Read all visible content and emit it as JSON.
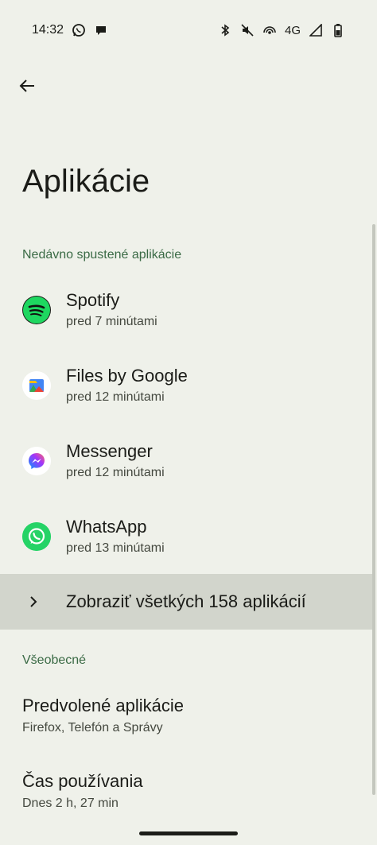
{
  "status": {
    "time": "14:32",
    "network": "4G"
  },
  "page": {
    "title": "Aplikácie"
  },
  "recent": {
    "header": "Nedávno spustené aplikácie",
    "apps": [
      {
        "name": "Spotify",
        "sub": "pred 7 minútami",
        "icon": "spotify-icon"
      },
      {
        "name": "Files by Google",
        "sub": "pred 12 minútami",
        "icon": "files-icon"
      },
      {
        "name": "Messenger",
        "sub": "pred 12 minútami",
        "icon": "messenger-icon"
      },
      {
        "name": "WhatsApp",
        "sub": "pred 13 minútami",
        "icon": "whatsapp-icon"
      }
    ],
    "show_all": "Zobraziť všetkých 158 aplikácií"
  },
  "general": {
    "header": "Všeobecné",
    "items": [
      {
        "title": "Predvolené aplikácie",
        "sub": "Firefox, Telefón a Správy"
      },
      {
        "title": "Čas používania",
        "sub": "Dnes 2 h, 27 min"
      }
    ]
  },
  "colors": {
    "background": "#eff1ea",
    "accent": "#3a6a45",
    "highlight": "#d2d5cc"
  }
}
